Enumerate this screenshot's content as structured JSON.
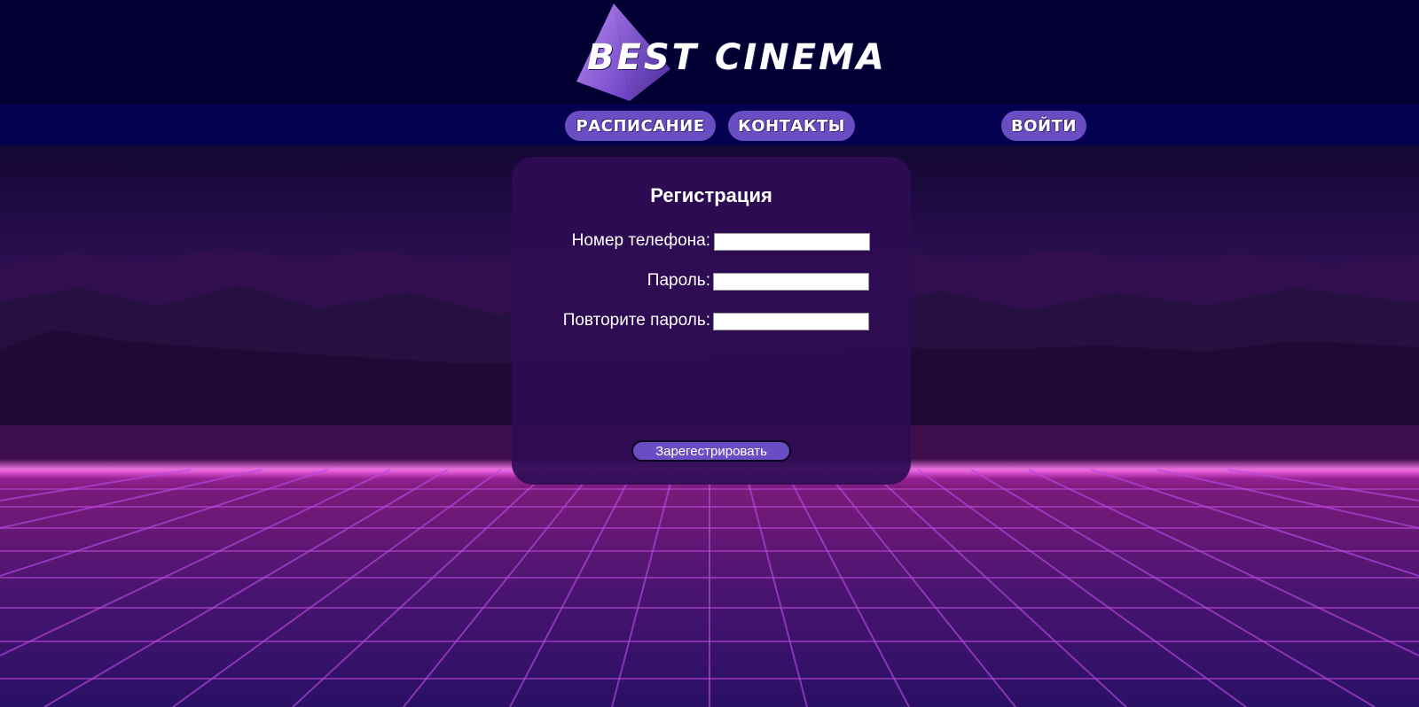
{
  "header": {
    "logo_alt": "logo-pyramid",
    "logo_word_1": "BEST",
    "logo_word_2": "CINEMA"
  },
  "nav": {
    "schedule": "РАСПИСАНИЕ",
    "contacts": "КОНТАКТЫ",
    "login": "ВОЙТИ"
  },
  "registration": {
    "title": "Регистрация",
    "fields": {
      "phone_label": "Номер телефона:",
      "phone_value": "",
      "password_label": "Пароль:",
      "password_value": "",
      "repeat_label": "Повторите пароль:",
      "repeat_value": ""
    },
    "submit_label": "Зарегестрировать"
  },
  "colors": {
    "header_bg": "#020033",
    "nav_bg": "#03004f",
    "button_bg": "#6a4dc2",
    "panel_bg": "#2e0c54",
    "grid_glow": "#e24bd8"
  },
  "icons": {
    "logo": "pyramid-icon"
  }
}
